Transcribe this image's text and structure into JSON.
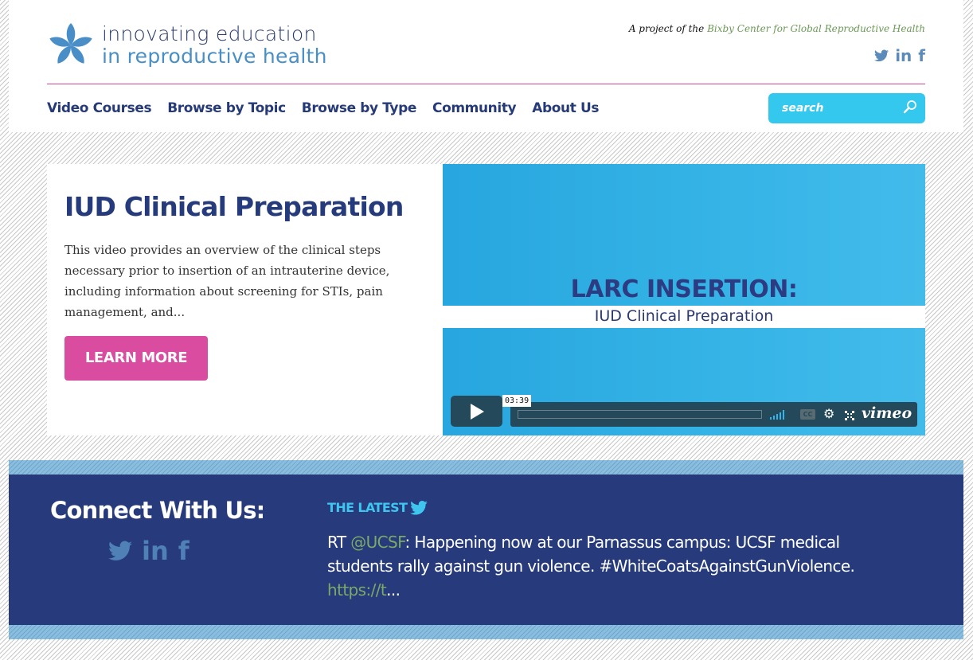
{
  "header": {
    "logo": {
      "line1": "innovating education",
      "line2": "in reproductive health",
      "icon": "flower-logo-icon"
    },
    "tagline_prefix": "A project of the ",
    "tagline_link": "Bixby Center for Global Reproductive Health",
    "social": [
      {
        "name": "twitter-icon"
      },
      {
        "name": "linkedin-icon",
        "glyph": "in"
      },
      {
        "name": "facebook-icon",
        "glyph": "f"
      }
    ],
    "nav": [
      "Video Courses",
      "Browse by Topic",
      "Browse by Type",
      "Community",
      "About Us"
    ],
    "search": {
      "placeholder": "search",
      "value": "",
      "icon": "search-icon"
    }
  },
  "feature": {
    "title": "IUD Clinical Preparation",
    "description": "This video provides an overview of the clinical steps necessary prior to insertion of an intrauterine device, including information about screening for STIs, pain management, and...",
    "button_label": "LEARN MORE",
    "video": {
      "title": "LARC INSERTION:",
      "subtitle": "IUD Clinical Preparation",
      "timecode": "03:39",
      "cc_label": "CC",
      "brand": "vimeo",
      "progress": 0
    }
  },
  "footer": {
    "connect_title": "Connect With Us:",
    "latest_label": "THE LATEST",
    "tweet": {
      "prefix": "RT ",
      "handle": "@UCSF",
      "body": ": Happening now at our Parnassus campus: UCSF medical students rally against gun violence. #WhiteCoatsAgainstGunViolence. ",
      "link": "https://t",
      "ellipsis": "..."
    }
  },
  "colors": {
    "navy": "#263a7c",
    "accent_pink": "#d94c9f",
    "search_cyan": "#34c8ee",
    "link_green": "#6a9a55",
    "light_band": "#89bede"
  }
}
